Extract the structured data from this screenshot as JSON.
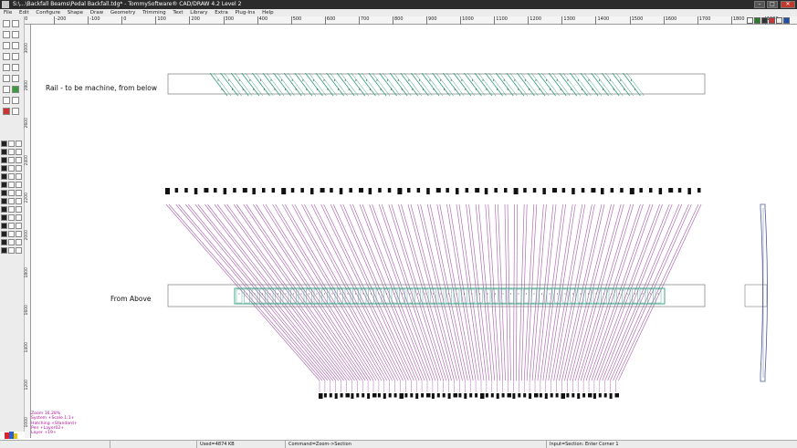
{
  "window": {
    "title": "S:\\...\\Backfall Beams\\Pedal Backfall.tdg* - TommySoftware® CAD/DRAW 4.2 Level 2",
    "min_label": "–",
    "max_label": "□",
    "close_label": "✕"
  },
  "menu": [
    "File",
    "Edit",
    "Configure",
    "Shape",
    "Draw",
    "Geometry",
    "Trimming",
    "Text",
    "Library",
    "Extra",
    "Plug-Ins",
    "Help"
  ],
  "ruler": {
    "top_ticks": [
      "10",
      "-200",
      "-100",
      "0",
      "100",
      "200",
      "300",
      "400",
      "500",
      "600",
      "700",
      "800",
      "900",
      "1000",
      "1100",
      "1200",
      "1300",
      "1400",
      "1500",
      "1600",
      "1700",
      "1800",
      "1900"
    ],
    "left_ticks": [
      "3000",
      "2800",
      "2600",
      "2400",
      "2200",
      "2000",
      "1800",
      "1600",
      "1400",
      "1200",
      "1000"
    ]
  },
  "drawing": {
    "rail_label": "Rail - to be machine, from below",
    "above_label": "From Above",
    "colors": {
      "beam": "#b06fb4",
      "rail_hatch": "#2f9e7d",
      "outline": "#7a7a7a",
      "block": "#111111",
      "side_view": "#4a5a9a"
    }
  },
  "info_panel": {
    "zoom": "Zoom 16.28%",
    "system": "System +Scale 1:1+",
    "hatching": "Hatching +Standard+",
    "pen": "Pen +Layer02+",
    "layer": "Layer +19+"
  },
  "statusbar": {
    "used": "Used=4874 KB",
    "command": "Command=Zoom->Section",
    "input": "Input=Section: Enter Corner 1"
  }
}
